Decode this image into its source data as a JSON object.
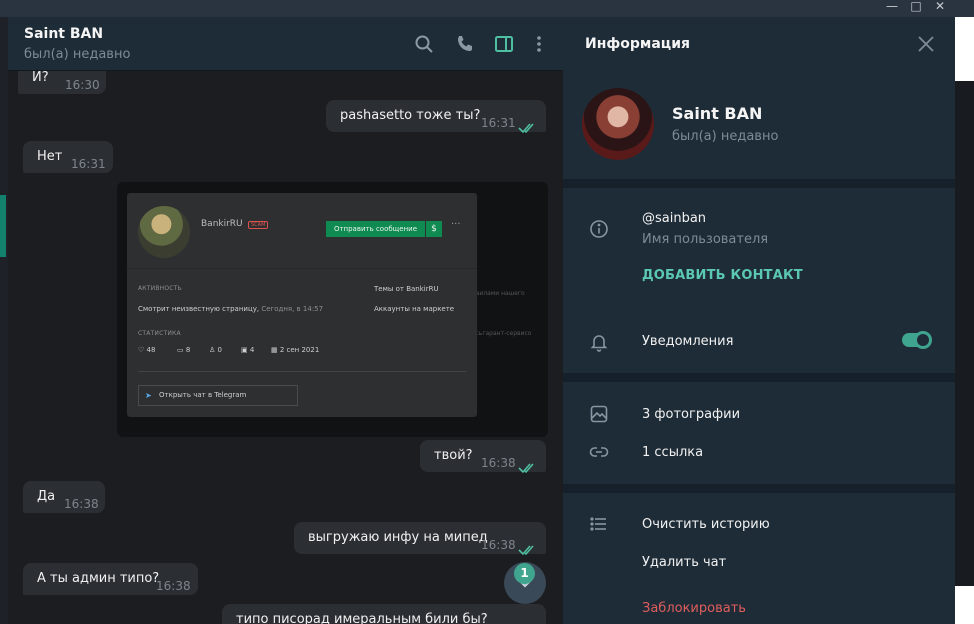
{
  "window": {
    "controls": [
      "—",
      "□",
      "✕"
    ]
  },
  "chat": {
    "header": {
      "name": "Saint BAN",
      "status": "был(а) недавно"
    },
    "messages": [
      {
        "dir": "in",
        "text": "И?",
        "time": "16:30"
      },
      {
        "dir": "out",
        "text": "pashasetto  тоже ты?",
        "time": "16:31"
      },
      {
        "dir": "in",
        "text": "Нет",
        "time": "16:31"
      },
      {
        "dir": "out",
        "text": "твой?",
        "time": "16:38"
      },
      {
        "dir": "in",
        "text": "Да",
        "time": "16:38"
      },
      {
        "dir": "out",
        "text": "выгружаю инфу на мипед",
        "time": "16:38"
      },
      {
        "dir": "in",
        "text": "А ты админ типо?",
        "time": "16:38"
      },
      {
        "dir": "out",
        "text": "типо писорад имеральным били бы?",
        "time": ""
      }
    ],
    "photo_card": {
      "username": "BankirRU",
      "scam_label": "SCAM",
      "send_button": "Отправить сообщение",
      "dollar": "$",
      "more": "···",
      "activity_label": "АКТИВНОСТЬ",
      "activity_text": "Смотрит неизвестную страницу,",
      "activity_time": "Сегодня, в 14:57",
      "topics_label": "Темы от BankirRU",
      "market_label": "Аккаунты на маркете",
      "stats_label": "СТАТИСТИКА",
      "stats": {
        "likes": "48",
        "comments": "8",
        "awards": "0",
        "gifts": "4",
        "date": "2 сен 2021"
      },
      "open_chat": "Открыть чат в Telegram",
      "ghost_1": "ааилами нашего",
      "ghost_2": "тсьгарант-сервисо"
    },
    "unread_badge": "1"
  },
  "info": {
    "title": "Информация",
    "name": "Saint BAN",
    "status": "был(а) недавно",
    "username": "@sainban",
    "username_label": "Имя пользователя",
    "add_contact": "ДОБАВИТЬ КОНТАКТ",
    "notifications": "Уведомления",
    "notifications_on": true,
    "photos": "3 фотографии",
    "links": "1 ссылка",
    "clear_history": "Очистить историю",
    "delete_chat": "Удалить чат",
    "block": "Заблокировать"
  },
  "colors": {
    "accent": "#3fa58e",
    "panel": "#1e2c37",
    "chat_bg": "#1b1d20",
    "bubble": "#2b2e33",
    "danger": "#e05d5d"
  }
}
